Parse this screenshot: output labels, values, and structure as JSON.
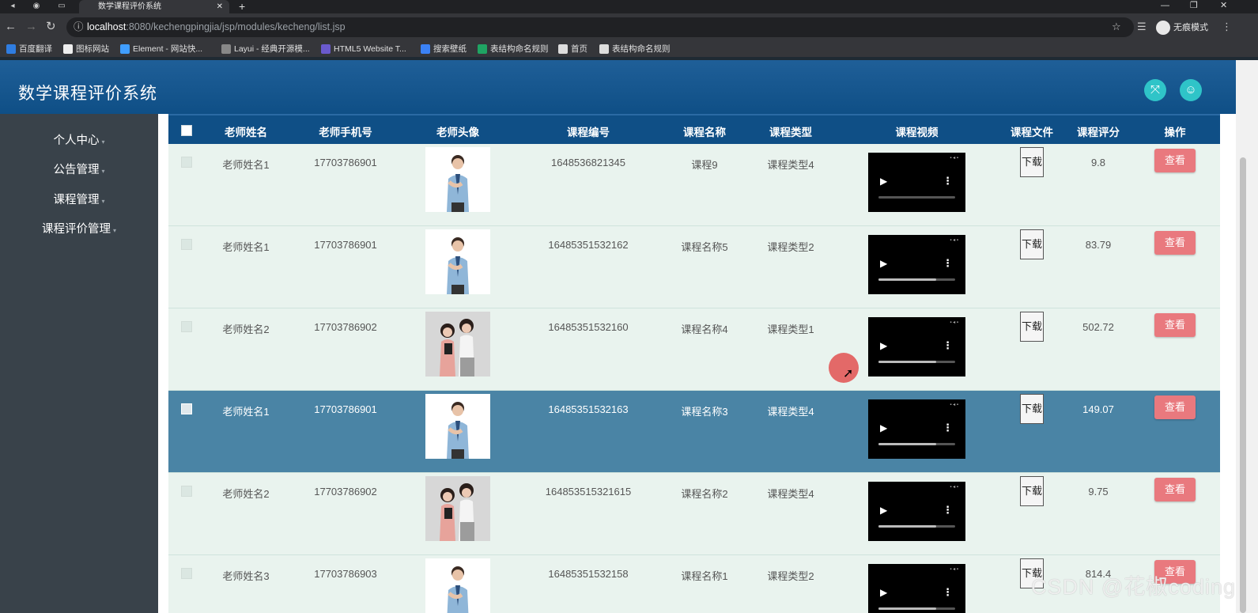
{
  "browser": {
    "tab_title": "数学课程评价系统",
    "tab_close": "✕",
    "new_tab": "+",
    "url_host": "localhost",
    "url_path": ":8080/kechengpingjia/jsp/modules/kecheng/list.jsp",
    "incognito_label": "无痕模式",
    "bookmarks": [
      {
        "label": "百度翻译",
        "icon_color": "#2f7de1"
      },
      {
        "label": "图标网站",
        "icon_color": "#eeeeee"
      },
      {
        "label": "Element - 网站快...",
        "icon_color": "#409eff"
      },
      {
        "label": "Layui - 经典开源模...",
        "icon_color": "#888888"
      },
      {
        "label": "HTML5 Website T...",
        "icon_color": "#6a5acd"
      },
      {
        "label": "搜索壁纸",
        "icon_color": "#3b82f6"
      },
      {
        "label": "表结构命名规则",
        "icon_color": "#1fa463"
      },
      {
        "label": "首页",
        "icon_color": "#dddddd"
      },
      {
        "label": "表结构命名规则",
        "icon_color": "#dddddd"
      }
    ]
  },
  "header": {
    "title": "数学课程评价系统"
  },
  "sidebar": {
    "items": [
      {
        "label": "个人中心"
      },
      {
        "label": "公告管理"
      },
      {
        "label": "课程管理"
      },
      {
        "label": "课程评价管理"
      }
    ]
  },
  "table": {
    "columns": [
      "老师姓名",
      "老师手机号",
      "老师头像",
      "课程编号",
      "课程名称",
      "课程类型",
      "课程视频",
      "课程文件",
      "课程评分",
      "操作"
    ],
    "download_label": "下载",
    "view_label": "查看",
    "rows": [
      {
        "teacher": "老师姓名1",
        "phone": "17703786901",
        "avatar": "man",
        "code": "1648536821345",
        "name": "课程9",
        "type": "课程类型4",
        "score": "9.8",
        "video_progress": 0.0,
        "selected": false
      },
      {
        "teacher": "老师姓名1",
        "phone": "17703786901",
        "avatar": "man",
        "code": "16485351532162",
        "name": "课程名称5",
        "type": "课程类型2",
        "score": "83.79",
        "video_progress": 0.75,
        "selected": false
      },
      {
        "teacher": "老师姓名2",
        "phone": "17703786902",
        "avatar": "women",
        "code": "16485351532160",
        "name": "课程名称4",
        "type": "课程类型1",
        "score": "502.72",
        "video_progress": 0.75,
        "selected": false
      },
      {
        "teacher": "老师姓名1",
        "phone": "17703786901",
        "avatar": "man",
        "code": "16485351532163",
        "name": "课程名称3",
        "type": "课程类型4",
        "score": "149.07",
        "video_progress": 0.75,
        "selected": true
      },
      {
        "teacher": "老师姓名2",
        "phone": "17703786902",
        "avatar": "women",
        "code": "164853515321615",
        "name": "课程名称2",
        "type": "课程类型4",
        "score": "9.75",
        "video_progress": 0.75,
        "selected": false
      },
      {
        "teacher": "老师姓名3",
        "phone": "17703786903",
        "avatar": "man",
        "code": "16485351532158",
        "name": "课程名称1",
        "type": "课程类型2",
        "score": "814.4",
        "video_progress": 0.75,
        "selected": false
      }
    ]
  },
  "watermark": "CSDN @花椒coding"
}
